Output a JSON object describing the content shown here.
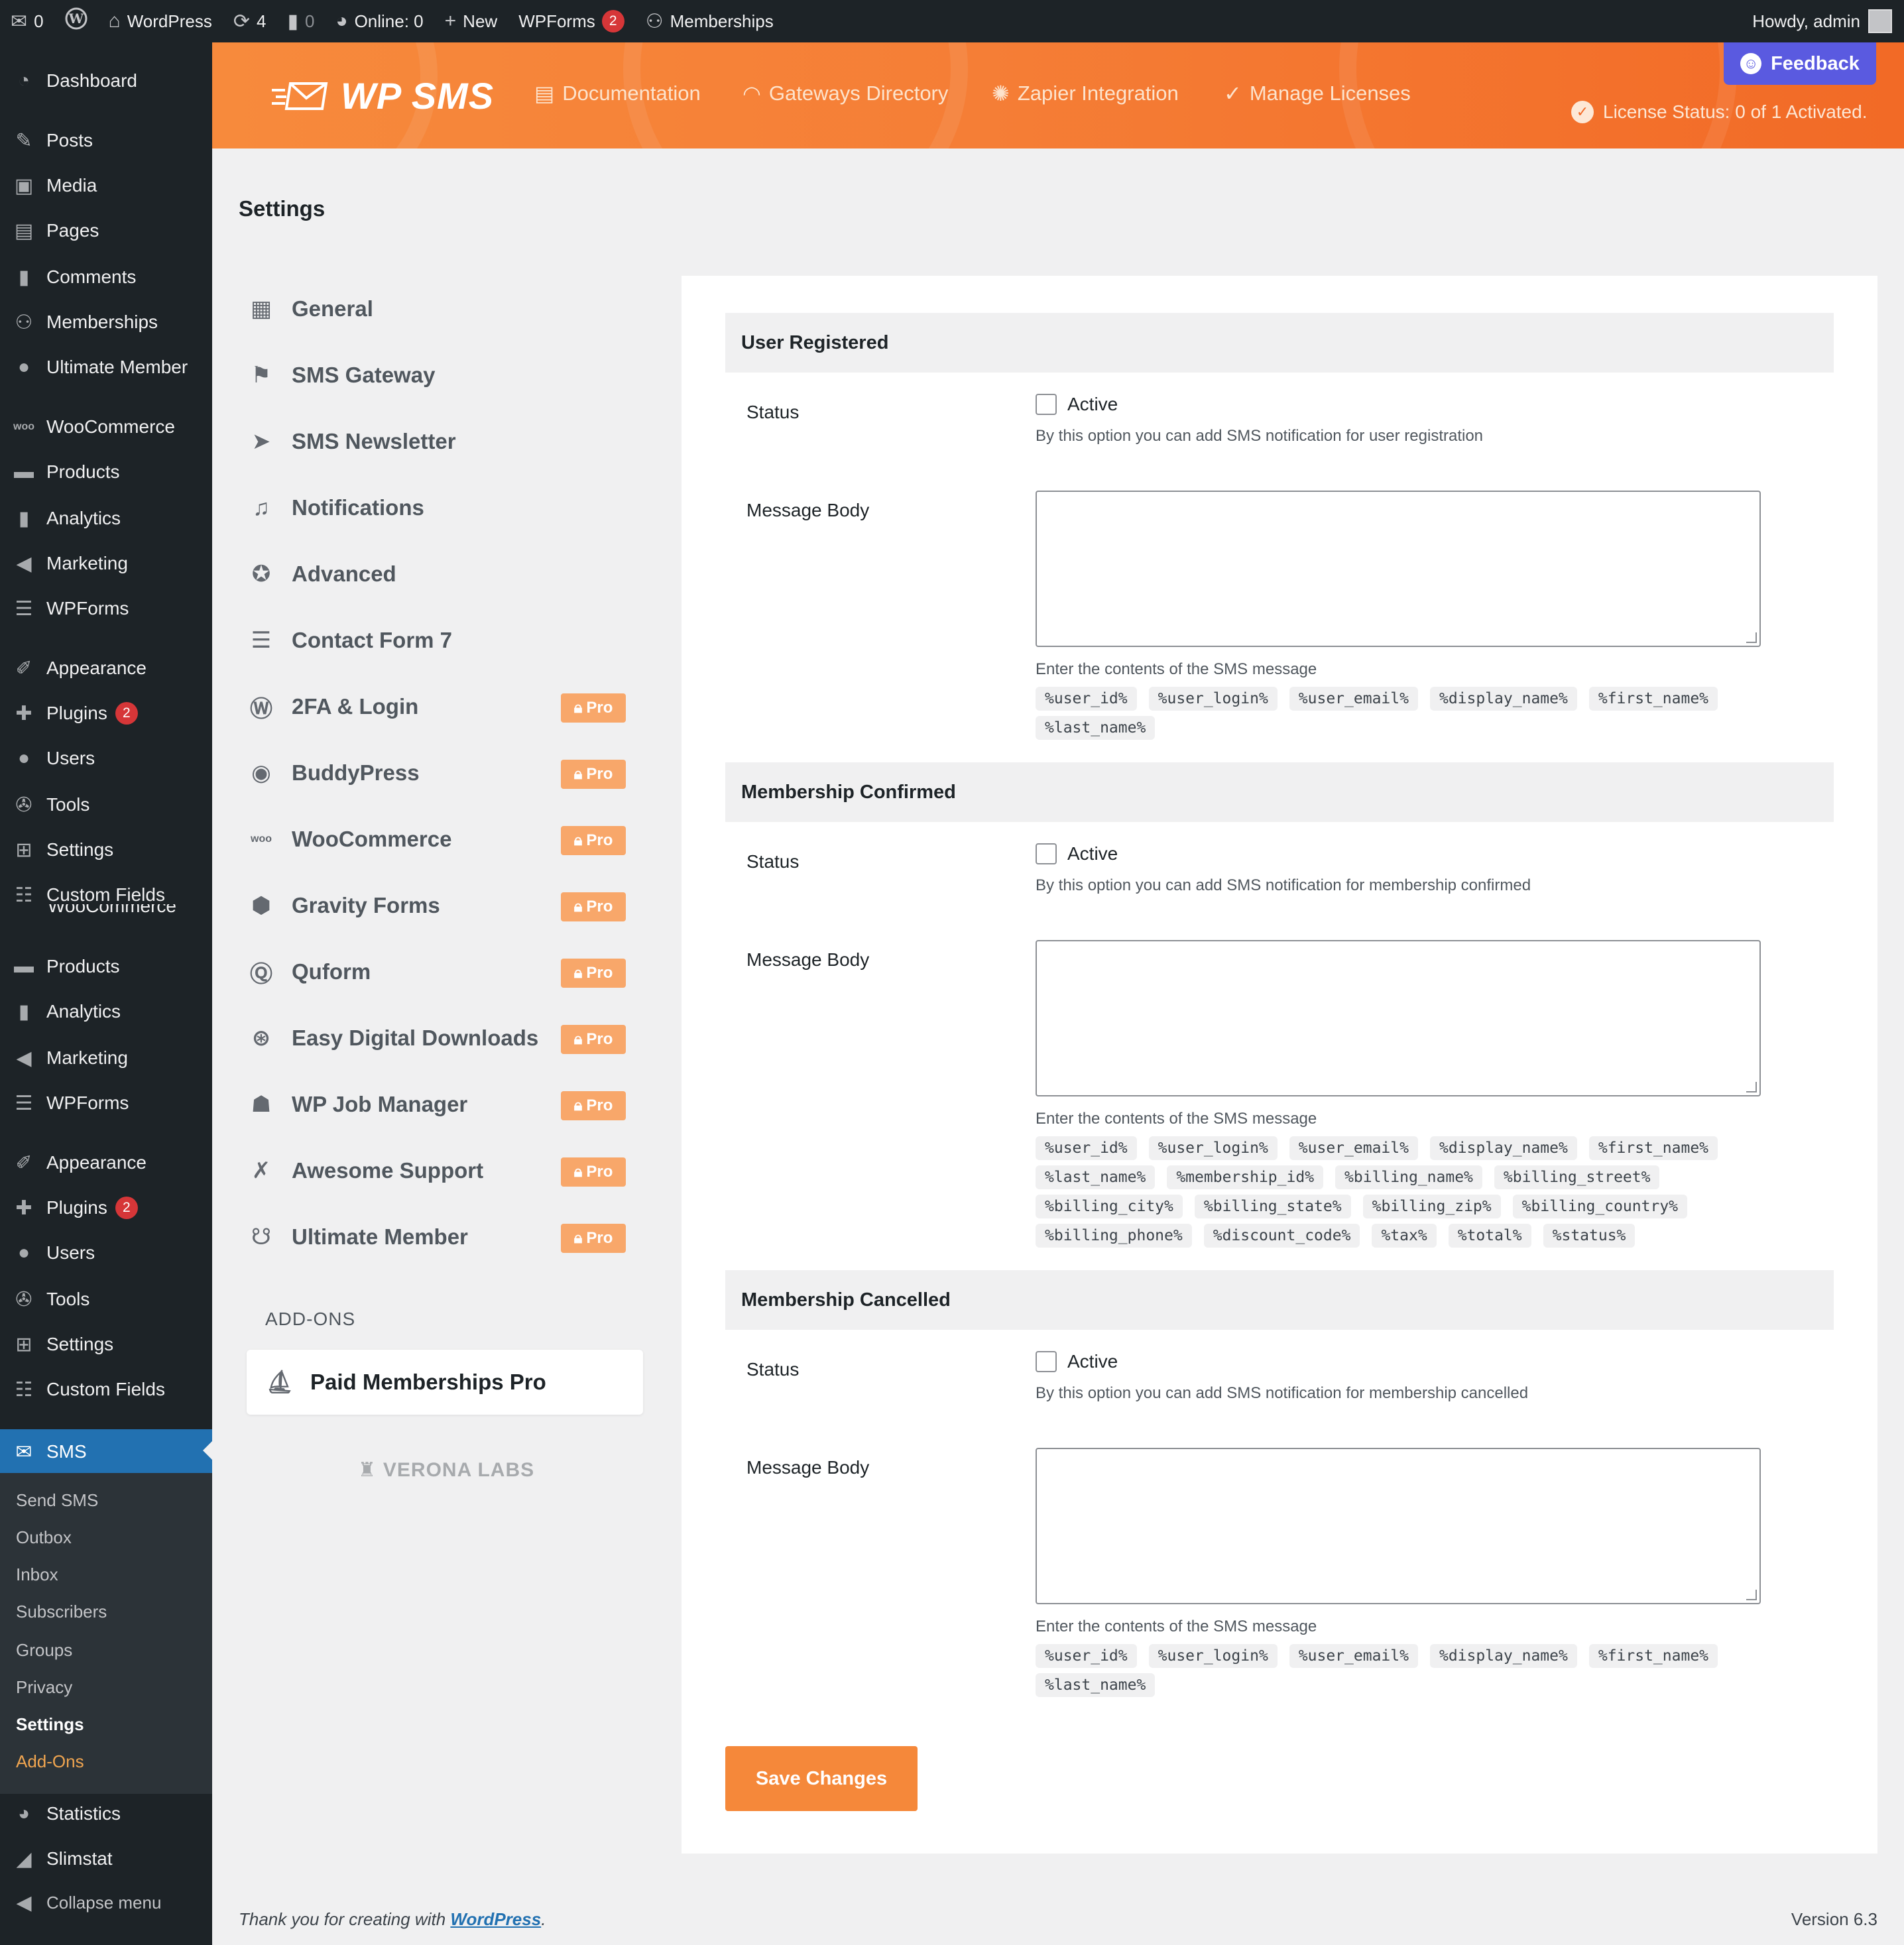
{
  "adminbar": {
    "mail_count": "0",
    "site_name": "WordPress",
    "updates_count": "4",
    "comments_count": "0",
    "online_label": "Online: 0",
    "new_label": "New",
    "wpforms_label": "WPForms",
    "wpforms_count": "2",
    "memberships_label": "Memberships",
    "howdy": "Howdy, admin"
  },
  "sidebar": {
    "dashboard": "Dashboard",
    "posts": "Posts",
    "media": "Media",
    "pages": "Pages",
    "comments": "Comments",
    "memberships": "Memberships",
    "ultimate_member": "Ultimate Member",
    "woocommerce": "WooCommerce",
    "products": "Products",
    "analytics": "Analytics",
    "marketing": "Marketing",
    "wpforms": "WPForms",
    "appearance": "Appearance",
    "plugins": "Plugins",
    "plugins_count": "2",
    "users": "Users",
    "tools": "Tools",
    "settings": "Settings",
    "custom_fields": "Custom Fields",
    "overlap_text": "WooCommerce",
    "sms": "SMS",
    "statistics": "Statistics",
    "slimstat": "Slimstat",
    "collapse": "Collapse menu",
    "submenu": [
      "Send SMS",
      "Outbox",
      "Inbox",
      "Subscribers",
      "Groups",
      "Privacy",
      "Settings",
      "Add-Ons"
    ]
  },
  "header": {
    "logo_text": "WP SMS",
    "nav": [
      "Documentation",
      "Gateways Directory",
      "Zapier Integration",
      "Manage Licenses"
    ],
    "feedback": "Feedback",
    "license_status": "License Status: 0 of 1 Activated."
  },
  "page": {
    "title": "Settings"
  },
  "settings_nav": {
    "items": [
      {
        "label": "General",
        "pro": false
      },
      {
        "label": "SMS Gateway",
        "pro": false
      },
      {
        "label": "SMS Newsletter",
        "pro": false
      },
      {
        "label": "Notifications",
        "pro": false
      },
      {
        "label": "Advanced",
        "pro": false
      },
      {
        "label": "Contact Form 7",
        "pro": false
      },
      {
        "label": "2FA & Login",
        "pro": true
      },
      {
        "label": "BuddyPress",
        "pro": true
      },
      {
        "label": "WooCommerce",
        "pro": true
      },
      {
        "label": "Gravity Forms",
        "pro": true
      },
      {
        "label": "Quform",
        "pro": true
      },
      {
        "label": "Easy Digital Downloads",
        "pro": true
      },
      {
        "label": "WP Job Manager",
        "pro": true
      },
      {
        "label": "Awesome Support",
        "pro": true
      },
      {
        "label": "Ultimate Member",
        "pro": true
      }
    ],
    "pro_label": "Pro",
    "addons_heading": "ADD-ONS",
    "addon_active": "Paid Memberships Pro",
    "brand": "VERONA LABS"
  },
  "sections": [
    {
      "heading": "User Registered",
      "status_label": "Status",
      "active_label": "Active",
      "status_desc": "By this option you can add SMS notification for user registration",
      "body_label": "Message Body",
      "body_value": "",
      "body_desc": "Enter the contents of the SMS message",
      "tags": [
        "%user_id%",
        "%user_login%",
        "%user_email%",
        "%display_name%",
        "%first_name%",
        "%last_name%"
      ]
    },
    {
      "heading": "Membership Confirmed",
      "status_label": "Status",
      "active_label": "Active",
      "status_desc": "By this option you can add SMS notification for membership confirmed",
      "body_label": "Message Body",
      "body_value": "",
      "body_desc": "Enter the contents of the SMS message",
      "tags": [
        "%user_id%",
        "%user_login%",
        "%user_email%",
        "%display_name%",
        "%first_name%",
        "%last_name%",
        "%membership_id%",
        "%billing_name%",
        "%billing_street%",
        "%billing_city%",
        "%billing_state%",
        "%billing_zip%",
        "%billing_country%",
        "%billing_phone%",
        "%discount_code%",
        "%tax%",
        "%total%",
        "%status%"
      ]
    },
    {
      "heading": "Membership Cancelled",
      "status_label": "Status",
      "active_label": "Active",
      "status_desc": "By this option you can add SMS notification for membership cancelled",
      "body_label": "Message Body",
      "body_value": "",
      "body_desc": "Enter the contents of the SMS message",
      "tags": [
        "%user_id%",
        "%user_login%",
        "%user_email%",
        "%display_name%",
        "%first_name%",
        "%last_name%"
      ]
    }
  ],
  "save_label": "Save Changes",
  "footer": {
    "thanks_prefix": "Thank you for creating with ",
    "thanks_link": "WordPress",
    "thanks_suffix": ".",
    "version": "Version 6.3"
  },
  "colors": {
    "accent": "#f5883a",
    "admin_dark": "#1d2327",
    "admin_blue": "#2271b1",
    "feedback": "#5a5ae0"
  }
}
